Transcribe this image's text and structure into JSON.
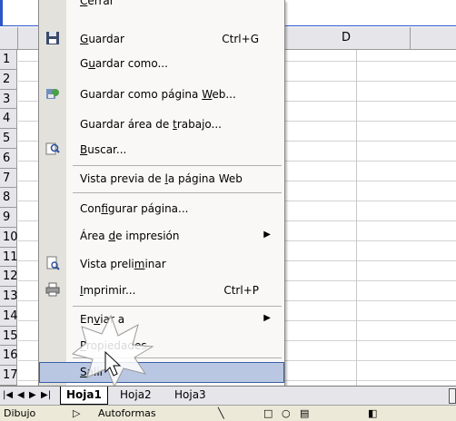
{
  "sheet": {
    "columns": [
      "D"
    ],
    "rows": [
      "1",
      "2",
      "3",
      "4",
      "5",
      "6",
      "7",
      "8",
      "9",
      "10",
      "11",
      "12",
      "13",
      "14",
      "15",
      "16",
      "17"
    ]
  },
  "menu": {
    "items": [
      {
        "name": "cerrar",
        "pre": "",
        "u": "C",
        "post": "errar",
        "shortcut": "",
        "icon": "",
        "arrow": ""
      },
      {
        "name": "guardar",
        "pre": "",
        "u": "G",
        "post": "uardar",
        "shortcut": "Ctrl+G",
        "icon": "floppy-icon",
        "arrow": ""
      },
      {
        "name": "guardar-como",
        "pre": "G",
        "u": "u",
        "post": "ardar como...",
        "shortcut": "",
        "icon": "",
        "arrow": ""
      },
      {
        "name": "guardar-web",
        "pre": "Guardar como página ",
        "u": "W",
        "post": "eb...",
        "shortcut": "",
        "icon": "web-save-icon",
        "arrow": ""
      },
      {
        "name": "guardar-area",
        "pre": "Guardar área de ",
        "u": "t",
        "post": "rabajo...",
        "shortcut": "",
        "icon": "",
        "arrow": ""
      },
      {
        "name": "buscar",
        "pre": "",
        "u": "B",
        "post": "uscar...",
        "shortcut": "",
        "icon": "search-icon",
        "arrow": ""
      },
      {
        "name": "vista-previa-web",
        "pre": "Vista previa de ",
        "u": "l",
        "post": "a página Web",
        "shortcut": "",
        "icon": "",
        "arrow": ""
      },
      {
        "name": "configurar-pagina",
        "pre": "Con",
        "u": "f",
        "post": "igurar página...",
        "shortcut": "",
        "icon": "",
        "arrow": ""
      },
      {
        "name": "area-impresion",
        "pre": "Área ",
        "u": "d",
        "post": "e impresión",
        "shortcut": "",
        "icon": "",
        "arrow": "▶"
      },
      {
        "name": "vista-preliminar",
        "pre": "Vista preli",
        "u": "m",
        "post": "inar",
        "shortcut": "",
        "icon": "preview-icon",
        "arrow": ""
      },
      {
        "name": "imprimir",
        "pre": "",
        "u": "I",
        "post": "mprimir...",
        "shortcut": "Ctrl+P",
        "icon": "printer-icon",
        "arrow": ""
      },
      {
        "name": "enviar-a",
        "pre": "En",
        "u": "v",
        "post": "iar a",
        "shortcut": "",
        "icon": "",
        "arrow": "▶"
      },
      {
        "name": "propiedades",
        "pre": "",
        "u": "P",
        "post": "ropiedades",
        "shortcut": "",
        "icon": "",
        "arrow": ""
      },
      {
        "name": "salir",
        "pre": "",
        "u": "S",
        "post": "alir",
        "shortcut": "",
        "icon": "",
        "arrow": ""
      }
    ]
  },
  "tabs": {
    "nav": [
      "|◀",
      "◀",
      "▶",
      "▶|"
    ],
    "sheets": [
      "Hoja1",
      "Hoja2",
      "Hoja3"
    ]
  },
  "drawbar": {
    "label": "Dibujo",
    "autoformas": "Autoformas"
  }
}
